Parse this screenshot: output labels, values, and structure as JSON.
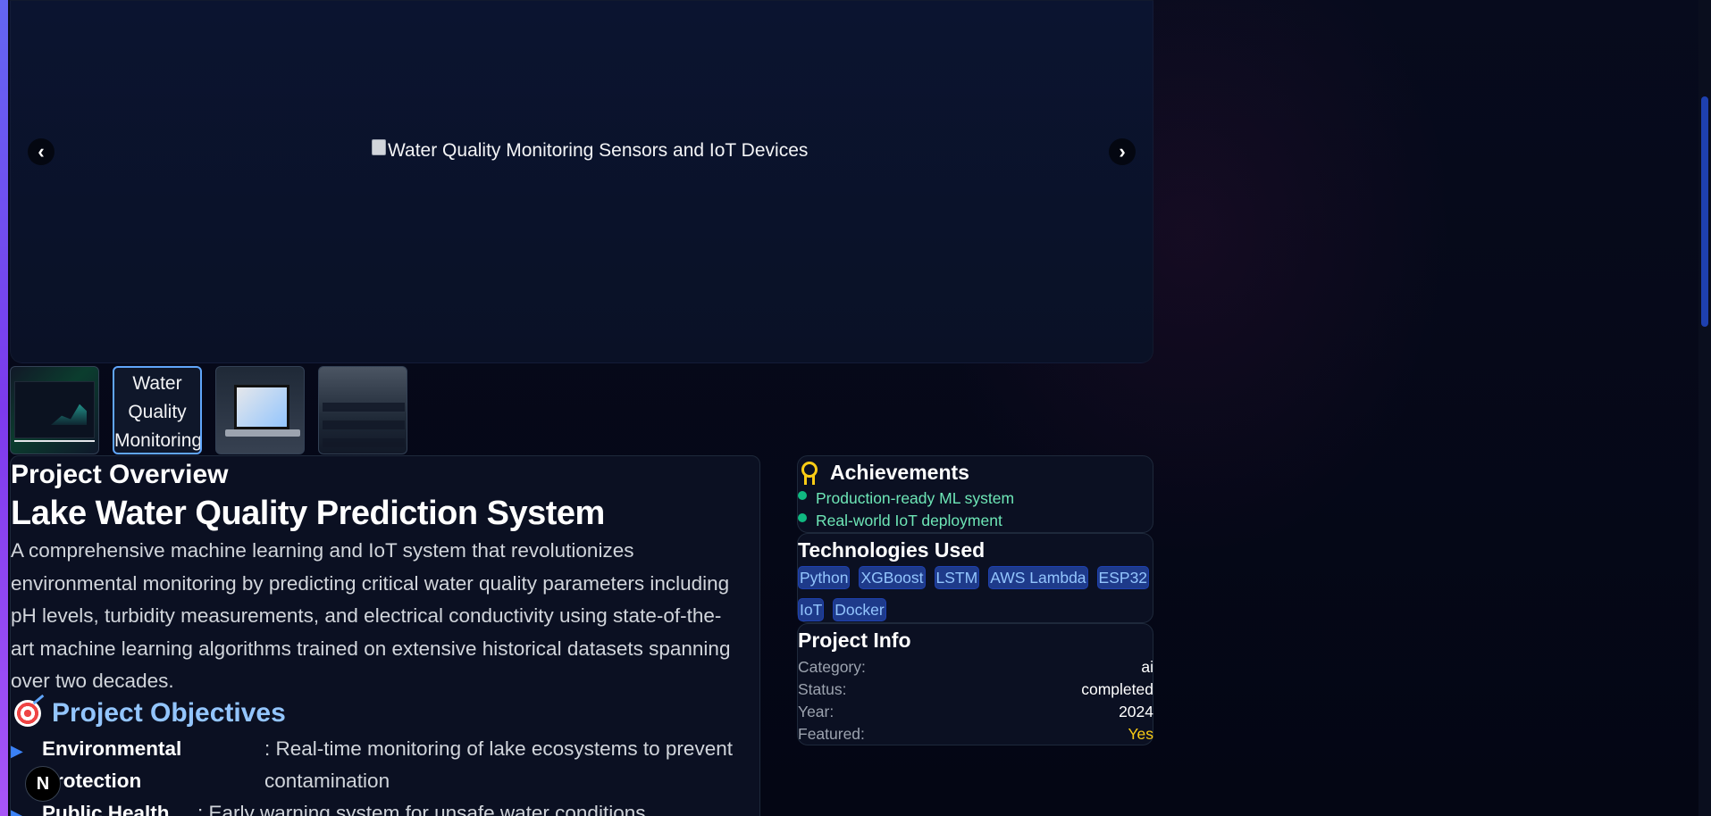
{
  "carousel": {
    "main_image_alt": "Water Quality Monitoring Sensors and IoT Devices",
    "prev_icon": "chevron-left-icon",
    "next_icon": "chevron-right-icon",
    "thumbnails": [
      {
        "alt": "",
        "active": false
      },
      {
        "alt": "Water Quality Monitoring",
        "active": true
      },
      {
        "alt": "",
        "active": false
      },
      {
        "alt": "",
        "active": false
      }
    ]
  },
  "overview": {
    "section_label": "Project Overview",
    "title": "Lake Water Quality Prediction System",
    "description": "A comprehensive machine learning and IoT system that revolutionizes environmental monitoring by predicting critical water quality parameters including pH levels, turbidity measurements, and electrical conductivity using state-of-the-art machine learning algorithms trained on extensive historical datasets spanning over two decades.",
    "objectives_heading": "Project Objectives",
    "objectives": [
      {
        "name_line1": "Environmental",
        "name_line2": "Protection",
        "desc_line1": ": Real-time monitoring of lake ecosystems to prevent",
        "desc_line2": "contamination"
      },
      {
        "name_line1": "Public Health",
        "desc_line1": ": Early warning system for unsafe water conditions"
      }
    ]
  },
  "achievements": {
    "heading": "Achievements",
    "items": [
      "Production-ready ML system",
      "Real-world IoT deployment"
    ]
  },
  "technologies": {
    "heading": "Technologies Used",
    "tags": [
      "Python",
      "XGBoost",
      "LSTM",
      "AWS Lambda",
      "ESP32",
      "IoT",
      "Docker"
    ]
  },
  "project_info": {
    "heading": "Project Info",
    "rows": [
      {
        "key": "Category:",
        "value": "ai"
      },
      {
        "key": "Status:",
        "value": "completed"
      },
      {
        "key": "Year:",
        "value": "2024"
      },
      {
        "key": "Featured:",
        "value": "Yes"
      }
    ]
  },
  "dev_badge": "N",
  "colors": {
    "accent": "#60a5fa",
    "heading_blue": "#93c5fd",
    "achievement_green": "#6ee7b7",
    "featured_yellow": "#facc15"
  }
}
